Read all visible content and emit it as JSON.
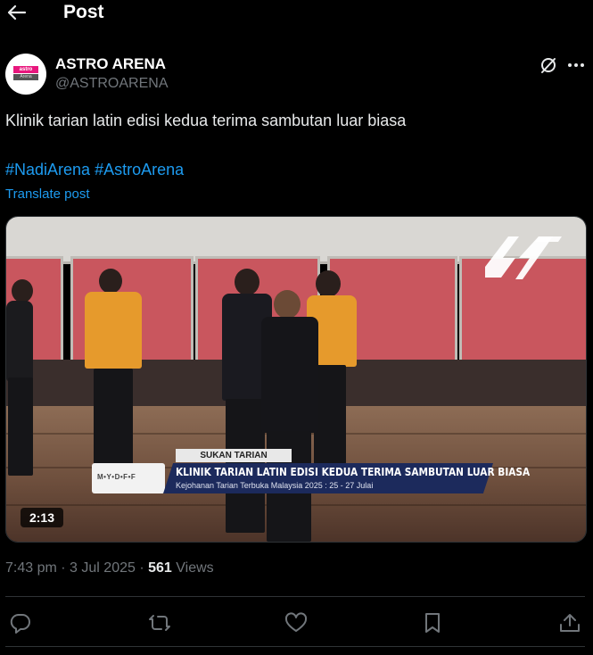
{
  "header": {
    "back_icon": "arrow-left-icon",
    "title": "Post"
  },
  "author": {
    "avatar_top_text": "astro",
    "avatar_bottom_text": "Arena",
    "display_name": "ASTRO ARENA",
    "handle": "@ASTROARENA",
    "grok_icon": "grok-icon",
    "more_icon": "more-icon"
  },
  "post": {
    "text": "Klinik tarian latin edisi kedua terima sambutan luar biasa",
    "hashtags": [
      "#NadiArena",
      "#AstroArena"
    ],
    "translate_label": "Translate post"
  },
  "media": {
    "type": "video",
    "duration": "2:13",
    "overlay": {
      "tag": "SUKAN TARIAN",
      "logo_text": "M•Y•D•F•F",
      "headline": "KLINIK TARIAN LATIN EDISI KEDUA TERIMA SAMBUTAN LUAR BIASA",
      "subline": "Kejohanan Tarian Terbuka Malaysia 2025 : 25 - 27 Julai"
    }
  },
  "meta": {
    "time": "7:43 pm",
    "separator": "·",
    "date": "3 Jul 2025",
    "views_count": "561",
    "views_label": "Views"
  },
  "actions": [
    {
      "name": "reply",
      "icon": "reply-icon"
    },
    {
      "name": "repost",
      "icon": "repost-icon"
    },
    {
      "name": "like",
      "icon": "heart-icon"
    },
    {
      "name": "bookmark",
      "icon": "bookmark-icon"
    },
    {
      "name": "share",
      "icon": "share-icon"
    }
  ],
  "colors": {
    "background": "#000000",
    "text": "#e7e9ea",
    "muted": "#71767b",
    "link": "#1d9bf0",
    "divider": "#2f3336"
  }
}
